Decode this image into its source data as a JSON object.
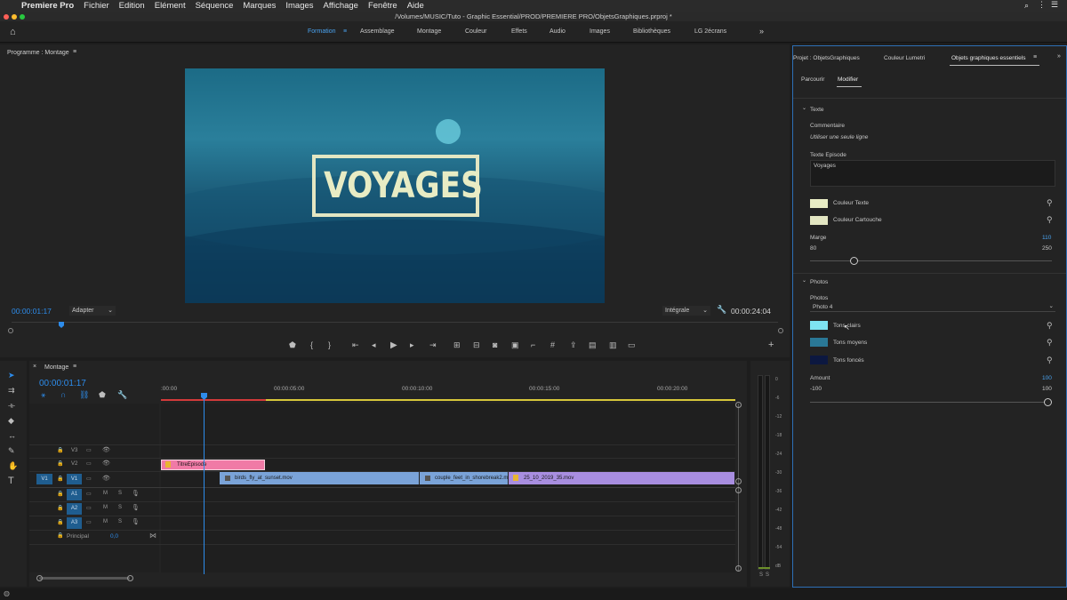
{
  "menubar": {
    "app": "Premiere Pro",
    "items": [
      "Fichier",
      "Edition",
      "Elément",
      "Séquence",
      "Marques",
      "Images",
      "Affichage",
      "Fenêtre",
      "Aide"
    ]
  },
  "window_title": "/Volumes/MUSIC/Tuto - Graphic Essential/PROD/PREMIERE PRO/ObjetsGraphiques.prproj *",
  "workspaces": [
    "Formation",
    "Assemblage",
    "Montage",
    "Couleur",
    "Effets",
    "Audio",
    "Images",
    "Bibliothèques",
    "LG 2écrans"
  ],
  "program": {
    "title": "Programme : Montage",
    "timecode": "00:00:01:17",
    "fit": "Adapter",
    "resolution": "Intégrale",
    "duration": "00:00:24:04",
    "overlay_text": "VOYAGES"
  },
  "timeline": {
    "title": "Montage",
    "timecode": "00:00:01:17",
    "ruler": [
      ":00:00",
      "00:00:05:00",
      "00:00:10:00",
      "00:00:15:00",
      "00:00:20:00"
    ],
    "tracks_video": [
      "V3",
      "V2",
      "V1"
    ],
    "tracks_audio": [
      "A1",
      "A2",
      "A3"
    ],
    "source_patch": "V1",
    "master_label": "Principal",
    "master_value": "0,0",
    "mute": "M",
    "solo": "S",
    "clips": [
      {
        "track": "V2",
        "name": "TitreEpisode",
        "color": "#f07aa6"
      },
      {
        "track": "V1",
        "name": "birds_fly_at_sunset.mov",
        "color": "#7aa3d8"
      },
      {
        "track": "V1",
        "name": "couple_feet_in_shorebreak2.m",
        "color": "#7aa3d8"
      },
      {
        "track": "V1",
        "name": "25_10_2019_35.mov",
        "color": "#a88ee0"
      }
    ]
  },
  "meter": {
    "scale": [
      "0",
      "-6",
      "-12",
      "-18",
      "-24",
      "-30",
      "-36",
      "-42",
      "-48",
      "-54",
      "dB"
    ],
    "solo_labels": [
      "S",
      "S"
    ]
  },
  "right_panel": {
    "tabs": [
      "Projet : ObjetsGraphiques",
      "Couleur Lumetri",
      "Objets graphiques essentiels"
    ],
    "subtabs": [
      "Parcourir",
      "Modifier"
    ],
    "text_section": "Texte",
    "comment_label": "Commentaire",
    "comment_value": "Utiliser une seule ligne",
    "episode_label": "Texte Episode",
    "episode_value": "Voyages",
    "color_text_label": "Couleur Texte",
    "color_text": "#e8ecc4",
    "color_cart_label": "Couleur Cartouche",
    "color_cart": "#e3e6c2",
    "margin_label": "Marge",
    "margin_value": "110",
    "margin_min": "80",
    "margin_max": "250",
    "margin_level": 0.18,
    "photos_section": "Photos",
    "photos_label": "Photos",
    "photos_select": "Photo 4",
    "tone_light_label": "Tons clairs",
    "tone_light": "#7ee4f2",
    "tone_mid_label": "Tons moyens",
    "tone_mid": "#2a7896",
    "tone_dark_label": "Tons foncés",
    "tone_dark": "#0c1840",
    "amount_label": "Amount",
    "amount_value": "100",
    "amount_min": "-100",
    "amount_max": "100",
    "amount_level": 1.0
  }
}
